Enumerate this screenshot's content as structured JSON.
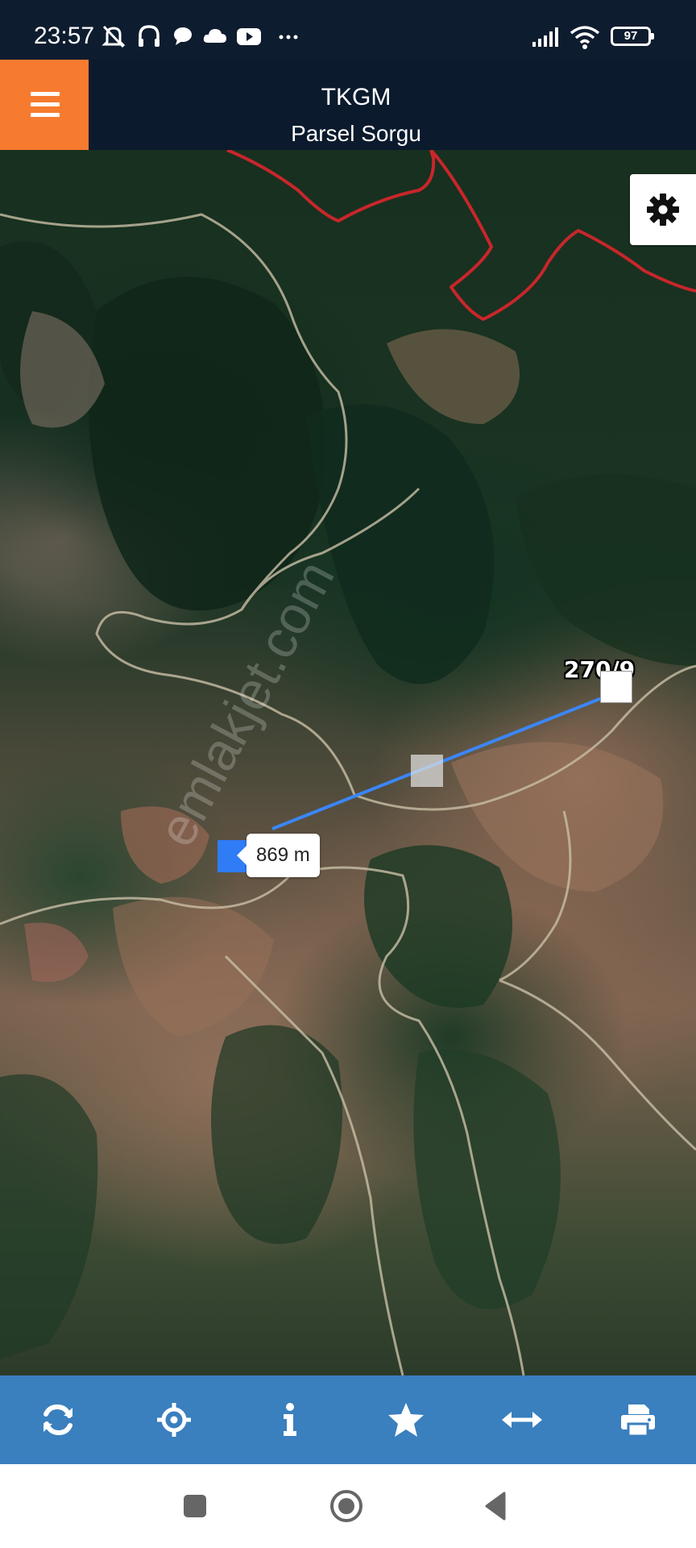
{
  "status_bar": {
    "time": "23:57",
    "battery": "97",
    "icons": [
      "mute-icon",
      "headphones-icon",
      "chat-icon",
      "cloud-icon",
      "youtube-icon",
      "more-icon",
      "signal-icon",
      "wifi-icon",
      "battery-icon"
    ]
  },
  "header": {
    "title": "TKGM",
    "subtitle": "Parsel Sorgu",
    "menu_icon": "hamburger-menu-icon",
    "accent_color": "#f77b2f",
    "background_color": "#0b1a2d"
  },
  "map": {
    "parcel_label": "270/9",
    "distance": "869 m",
    "watermark": "emlakjet.com",
    "settings_icon": "gear-icon",
    "boundary_color": "#c8262b",
    "measure_line_color": "#3b86f7"
  },
  "toolbar": {
    "background_color": "#3a7fbe",
    "buttons": [
      {
        "name": "refresh",
        "icon": "refresh-icon"
      },
      {
        "name": "locate",
        "icon": "crosshair-icon"
      },
      {
        "name": "info",
        "icon": "info-icon"
      },
      {
        "name": "favorites",
        "icon": "star-icon"
      },
      {
        "name": "measure",
        "icon": "horizontal-arrows-icon"
      },
      {
        "name": "print",
        "icon": "printer-icon"
      }
    ]
  },
  "nav_bar": {
    "buttons": [
      "recents-square-icon",
      "home-circle-icon",
      "back-triangle-icon"
    ]
  }
}
